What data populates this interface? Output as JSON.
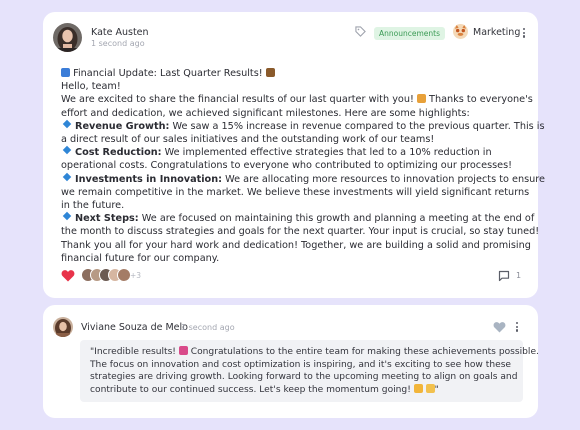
{
  "post": {
    "author": "Kate Austen",
    "time": "1 second ago",
    "tag_icon": "tag-icon",
    "badge": "Announcements",
    "group": "Marketing",
    "lines": [
      {
        "segments": [
          {
            "emoji": "chart-emoji"
          },
          {
            "text": " Financial Update: Last Quarter Results! "
          },
          {
            "emoji": "briefcase-emoji"
          }
        ]
      },
      {
        "segments": [
          {
            "text": "Hello, team!"
          }
        ]
      },
      {
        "segments": [
          {
            "text": "We are excited to share the financial results of our last quarter with you! "
          },
          {
            "emoji": "party-emoji"
          },
          {
            "text": " Thanks to everyone's"
          }
        ]
      },
      {
        "segments": [
          {
            "text": "effort and dedication, we achieved significant milestones. Here are some highlights:"
          }
        ]
      },
      {
        "bullet": true,
        "segments": [
          {
            "bold": "Revenue Growth:"
          },
          {
            "text": " We saw a 15% increase in revenue compared to the previous quarter. This is"
          }
        ]
      },
      {
        "segments": [
          {
            "text": "a direct result of our sales initiatives and the outstanding work of our teams!"
          }
        ]
      },
      {
        "bullet": true,
        "segments": [
          {
            "bold": "Cost Reduction:"
          },
          {
            "text": " We implemented effective strategies that led to a 10% reduction in"
          }
        ]
      },
      {
        "segments": [
          {
            "text": "operational costs. Congratulations to everyone who contributed to optimizing our processes!"
          }
        ]
      },
      {
        "bullet": true,
        "segments": [
          {
            "bold": "Investments in Innovation:"
          },
          {
            "text": " We are allocating more resources to innovation projects to ensure"
          }
        ]
      },
      {
        "segments": [
          {
            "text": "we remain competitive in the market. We believe these investments will yield significant returns"
          }
        ]
      },
      {
        "segments": [
          {
            "text": "in the future."
          }
        ]
      },
      {
        "bullet": true,
        "segments": [
          {
            "bold": "Next Steps:"
          },
          {
            "text": " We are focused on maintaining this growth and planning a meeting at the end of"
          }
        ]
      },
      {
        "segments": [
          {
            "text": "the month to discuss strategies and goals for the next quarter. Your input is crucial, so stay tuned!"
          }
        ]
      },
      {
        "segments": [
          {
            "text": "Thank you all for your hard work and dedication! Together, we are building a solid and promising"
          }
        ]
      },
      {
        "segments": [
          {
            "text": "financial future for our company."
          }
        ]
      }
    ],
    "reactions_extra": "+3",
    "comments_count": "1"
  },
  "comment": {
    "author": "Viviane Souza de Melo",
    "time": "1 second ago",
    "lines": [
      {
        "segments": [
          {
            "text": "\"Incredible results! "
          },
          {
            "emoji": "rocket-emoji"
          },
          {
            "text": " Congratulations to the entire team for making these achievements possible."
          }
        ]
      },
      {
        "segments": [
          {
            "text": "The focus on innovation and cost optimization is inspiring, and it's exciting to see how these"
          }
        ]
      },
      {
        "segments": [
          {
            "text": "strategies are driving growth. Looking forward to the upcoming meeting to align on goals and"
          }
        ]
      },
      {
        "segments": [
          {
            "text": "contribute to our continued success. Let's keep the momentum going! "
          },
          {
            "emoji": "muscle-emoji"
          },
          {
            "text": " "
          },
          {
            "emoji": "clap-emoji"
          },
          {
            "text": "\""
          }
        ]
      }
    ]
  },
  "colors": {
    "background": "#e6e3fb",
    "card": "#ffffff",
    "badge_bg": "#dff4e4",
    "badge_text": "#3b9b55",
    "bullet": "#2f86d6",
    "heart": "#e8334a",
    "quote_bg": "#f1f2f5"
  },
  "emoji_colors": {
    "chart-emoji": "#3b7dd8",
    "briefcase-emoji": "#8a5a2b",
    "party-emoji": "#e8a13a",
    "rocket-emoji": "#d94a8a",
    "muscle-emoji": "#f2b53a",
    "clap-emoji": "#f2c14e"
  }
}
